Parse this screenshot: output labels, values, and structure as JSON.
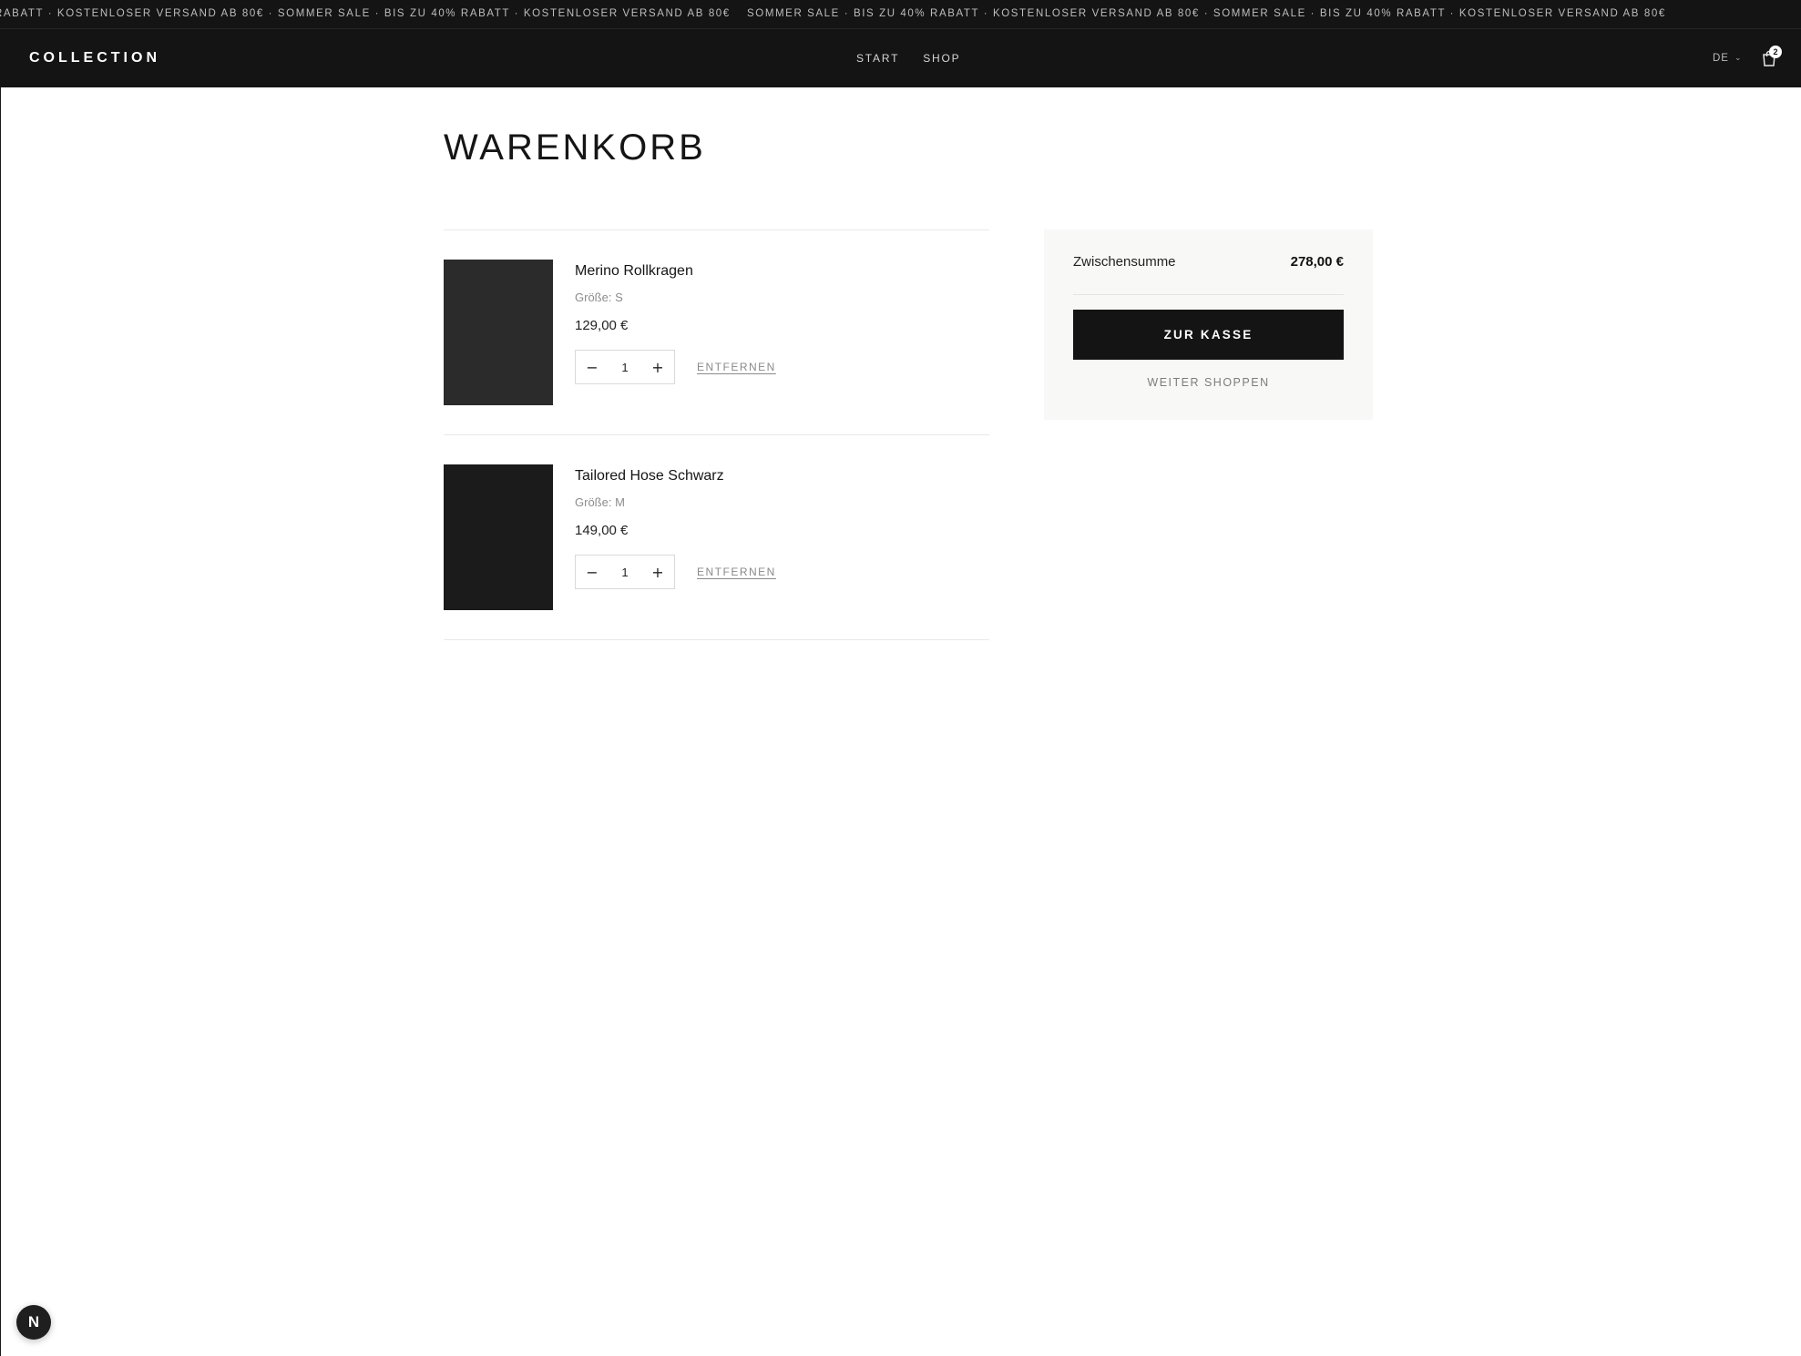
{
  "announcement": {
    "text_a": "RABATT · KOSTENLOSER VERSAND AB 80€ · SOMMER SALE · BIS ZU 40% RABATT · KOSTENLOSER VERSAND AB 80€",
    "text_b": "SOMMER SALE · BIS ZU 40% RABATT · KOSTENLOSER VERSAND AB 80€ · SOMMER SALE · BIS ZU 40% RABATT · KOSTENLOSER VERSAND AB 80€"
  },
  "header": {
    "logo": "COLLECTION",
    "nav": [
      {
        "label": "START"
      },
      {
        "label": "SHOP"
      }
    ],
    "language": "DE",
    "cart_count": "2"
  },
  "cart": {
    "title": "WARENKORB",
    "items": [
      {
        "name": "Merino Rollkragen",
        "size": "Größe: S",
        "price": "129,00 €",
        "quantity": "1",
        "remove_label": "ENTFERNEN",
        "image_color": "#2b2b2b"
      },
      {
        "name": "Tailored Hose Schwarz",
        "size": "Größe: M",
        "price": "149,00 €",
        "quantity": "1",
        "remove_label": "ENTFERNEN",
        "image_color": "#1b1b1b"
      }
    ]
  },
  "summary": {
    "subtotal_label": "Zwischensumme",
    "subtotal_value": "278,00 €",
    "checkout_label": "ZUR KASSE",
    "continue_label": "WEITER SHOPPEN"
  },
  "dev_badge": {
    "letter": "N"
  },
  "colors": {
    "header_bg": "#141414",
    "summary_bg": "#f8f8f6",
    "button_bg": "#141414"
  }
}
